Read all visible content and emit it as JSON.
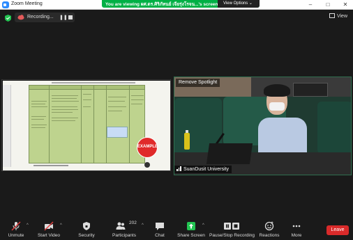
{
  "window": {
    "title": "Zoom Meeting",
    "controls": [
      "–",
      "□",
      "✕"
    ]
  },
  "share_banner": {
    "text": "You are viewing ผศ.ดร.ศิริภัทนย์ เจียรุ่งโรจน...'s screen",
    "view_options": "View Options ⌄"
  },
  "recording": {
    "label": "Recording...",
    "pause_glyph": "❚❚"
  },
  "view_button": {
    "label": "View"
  },
  "shared_screen": {
    "stamp_text": "EXAMPLE"
  },
  "speaker": {
    "remove_spotlight": "Remove Spotlight",
    "name": "SuanDusit University"
  },
  "toolbar": {
    "unmute": "Unmute",
    "start_video": "Start Video",
    "security": "Security",
    "participants": "Participants",
    "participant_count": "202",
    "chat": "Chat",
    "share_screen": "Share Screen",
    "pause_recording": "Pause/Stop Recording",
    "reactions": "Reactions",
    "more": "More",
    "leave": "Leave"
  },
  "colors": {
    "share_green": "#00b045",
    "leave_red": "#d92a2a",
    "zoom_blue": "#2d8cff",
    "table_green": "#bed38e"
  }
}
